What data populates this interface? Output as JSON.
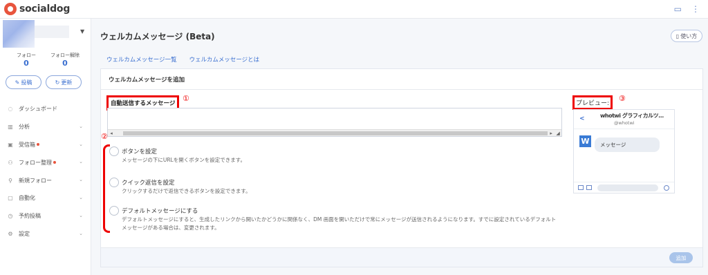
{
  "app": {
    "logo_text": "socialdog"
  },
  "topbar": {
    "icons": [
      "keyboard-icon",
      "more-vert-icon"
    ]
  },
  "account": {
    "stats": [
      {
        "label": "フォロー",
        "value": "0"
      },
      {
        "label": "フォロー解除",
        "value": "0"
      }
    ],
    "post_label": "投稿",
    "refresh_label": "更新"
  },
  "nav": [
    {
      "label": "ダッシュボード",
      "icon": "bulb-icon",
      "dot": false,
      "caret": false
    },
    {
      "label": "分析",
      "icon": "bar-chart-icon",
      "dot": false,
      "caret": true
    },
    {
      "label": "受信箱",
      "icon": "inbox-icon",
      "dot": true,
      "caret": true
    },
    {
      "label": "フォロー整理",
      "icon": "people-icon",
      "dot": true,
      "caret": true
    },
    {
      "label": "新規フォロー",
      "icon": "search-icon",
      "dot": false,
      "caret": true
    },
    {
      "label": "自動化",
      "icon": "robot-icon",
      "dot": false,
      "caret": true
    },
    {
      "label": "予約投稿",
      "icon": "clock-icon",
      "dot": false,
      "caret": true
    },
    {
      "label": "設定",
      "icon": "gear-icon",
      "dot": false,
      "caret": true
    }
  ],
  "page": {
    "title": "ウェルカムメッセージ (Beta)",
    "help_label": "使い方",
    "tabs": [
      "ウェルカムメッセージ一覧",
      "ウェルカムメッセージとは"
    ]
  },
  "panel": {
    "header": "ウェルカムメッセージを追加",
    "message_label": "自動送信するメッセージ",
    "message_value": "",
    "annotations": {
      "a1": "①",
      "a2": "②",
      "a3": "③"
    },
    "options": [
      {
        "title": "ボタンを設定",
        "desc": "メッセージの下にURLを開くボタンを設定できます。"
      },
      {
        "title": "クイック返信を設定",
        "desc": "クリックするだけで返信できるボタンを設定できます。"
      },
      {
        "title": "デフォルトメッセージにする",
        "desc": "デフォルトメッセージにすると、生成したリンクから開いたかどうかに関係なく、DM 画面を開いただけで常にメッセージが送信されるようになります。すでに設定されているデフォルトメッセージがある場合は、変更されます。"
      }
    ],
    "add_label": "追加"
  },
  "preview": {
    "label": "プレビュー:",
    "name": "whotwi グラフィカルツ...",
    "handle": "@whotwi",
    "avatar_letter": "W",
    "message": "メッセージ"
  },
  "colors": {
    "accent": "#3a6fd0",
    "brand": "#e8553e",
    "annotation": "#e00000"
  }
}
